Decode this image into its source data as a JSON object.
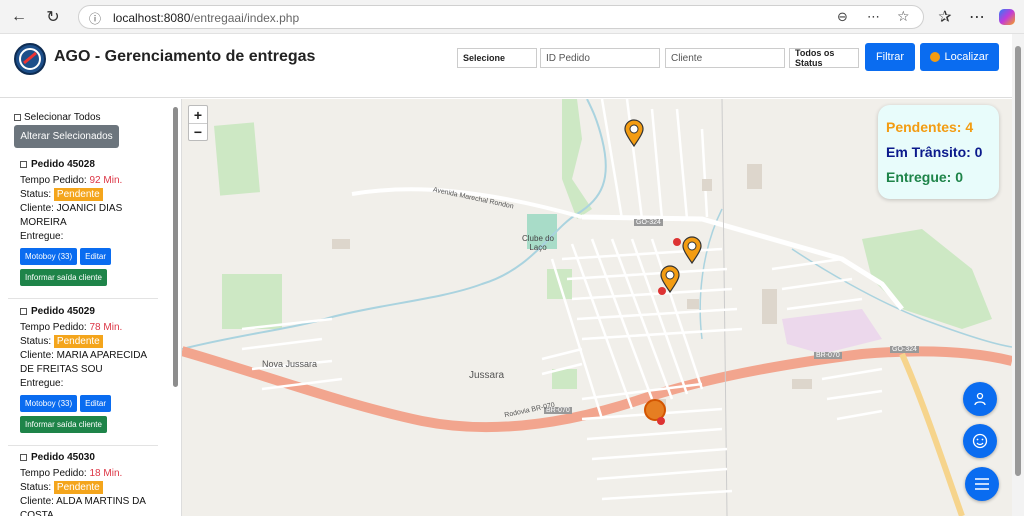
{
  "browser": {
    "url_host": "localhost:8080",
    "url_path": "/entregaai/index.php"
  },
  "header": {
    "title": "AGO - Gerenciamento de entregas",
    "filter_select": "Selecione",
    "order_id_placeholder": "ID Pedido",
    "client_placeholder": "Cliente",
    "status_select": "Todos os Status",
    "filter_button": "Filtrar",
    "locate_button": "Localizar"
  },
  "sidebar": {
    "select_all": "Selecionar Todos",
    "alter_selected": "Alterar Selecionados",
    "orders": [
      {
        "title": "Pedido 45028",
        "time_label": "Tempo Pedido:",
        "time_value": "92 Min.",
        "status_label": "Status:",
        "status_value": "Pendente",
        "client": "Cliente: JOANICI DIAS MOREIRA",
        "delivered": "Entregue:",
        "motoboy_button": "Motoboy (33)",
        "edit_button": "Editar",
        "inform_button": "Informar saída cliente"
      },
      {
        "title": "Pedido 45029",
        "time_label": "Tempo Pedido:",
        "time_value": "78 Min.",
        "status_label": "Status:",
        "status_value": "Pendente",
        "client": "Cliente: MARIA APARECIDA DE FREITAS SOU",
        "delivered": "Entregue:",
        "motoboy_button": "Motoboy (33)",
        "edit_button": "Editar",
        "inform_button": "Informar saída cliente"
      },
      {
        "title": "Pedido 45030",
        "time_label": "Tempo Pedido:",
        "time_value": "18 Min.",
        "status_label": "Status:",
        "status_value": "Pendente",
        "client": "Cliente: ALDA MARTINS DA COSTA"
      }
    ]
  },
  "map": {
    "stats": {
      "pending": "Pendentes: 4",
      "in_transit": "Em Trânsito: 0",
      "delivered": "Entregue: 0"
    },
    "labels": {
      "city": "Jussara",
      "district": "Nova Jussara",
      "club": "Clube do Laço",
      "road_go": "GO-324",
      "road_br": "BR-070",
      "highway": "Rodovia BR-070",
      "avenue": "Avenida Marechal Rondon"
    },
    "zoom_in": "+",
    "zoom_out": "−"
  },
  "colors": {
    "pending": "#f39c12",
    "in_transit": "#0b1a8c",
    "delivered": "#1e8449",
    "primary": "#0a6cf0"
  }
}
